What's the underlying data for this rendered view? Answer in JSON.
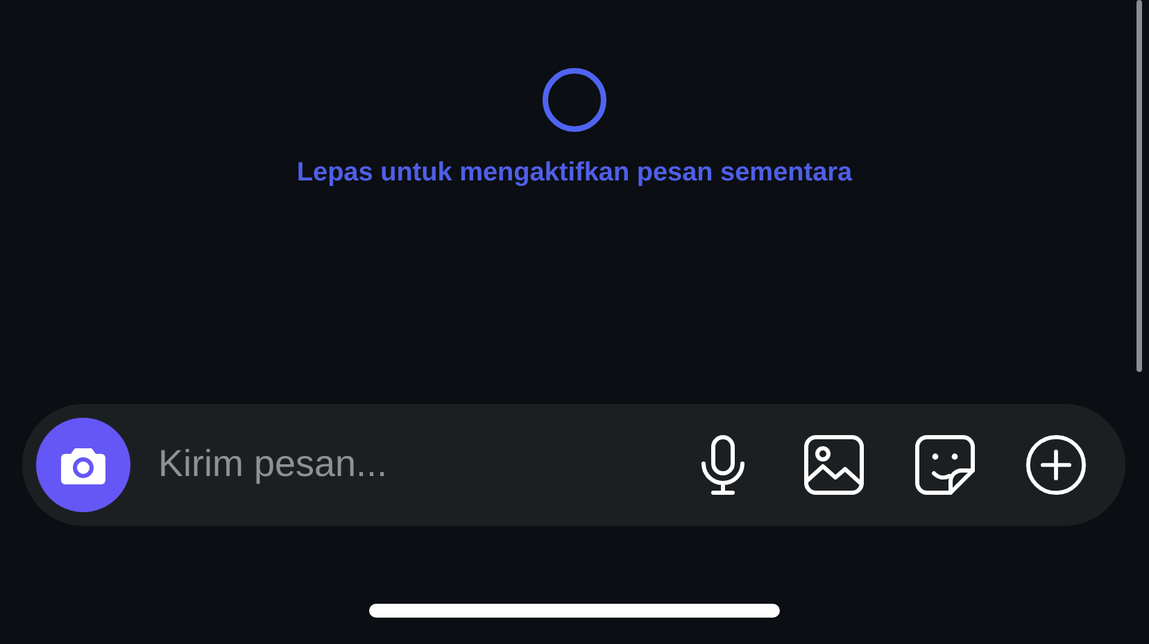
{
  "release_hint": {
    "text": "Lepas untuk mengaktifkan pesan sementara"
  },
  "composer": {
    "placeholder": "Kirim pesan...",
    "actions": [
      {
        "kind": "microphone"
      },
      {
        "kind": "image"
      },
      {
        "kind": "sticker"
      },
      {
        "kind": "plus"
      }
    ]
  }
}
